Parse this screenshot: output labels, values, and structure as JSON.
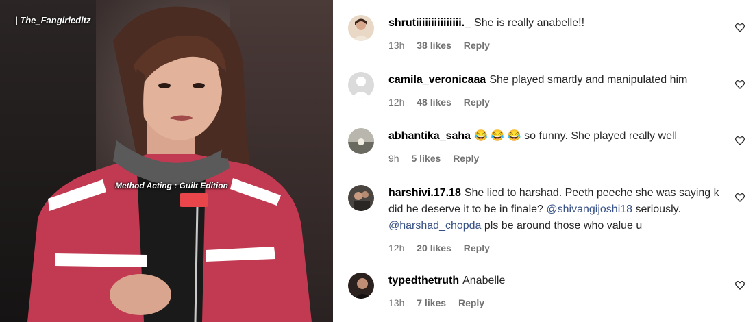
{
  "media": {
    "watermark": "| The_Fangirleditz",
    "caption": "Method Acting : Guilt Edition"
  },
  "icons": {
    "like": "heart-outline-icon",
    "avatar_default": "user-silhouette-icon"
  },
  "colors": {
    "mention": "#385185",
    "meta": "#737373"
  },
  "comments": [
    {
      "username": "shrutiiiiiiiiiiiiiii._",
      "text": "She is really anabelle!!",
      "time": "13h",
      "likes": "38 likes",
      "reply": "Reply"
    },
    {
      "username": "camila_veronicaaa",
      "text": "She played smartly and manipulated him",
      "time": "12h",
      "likes": "48 likes",
      "reply": "Reply"
    },
    {
      "username": "abhantika_saha",
      "emoji": "😂 😂 😂",
      "text": "so funny. She played really well",
      "time": "9h",
      "likes": "5 likes",
      "reply": "Reply"
    },
    {
      "username": "harshivi.17.18",
      "text_a": "She lied to harshad. Peeth peeche she was saying k did he deserve it to be in finale?",
      "mention_a": "@shivangijoshi18",
      "text_b": "seriously.",
      "mention_b": "@harshad_chopda",
      "text_c": "pls be around those who value u",
      "time": "12h",
      "likes": "20 likes",
      "reply": "Reply"
    },
    {
      "username": "typedthetruth",
      "text": "Anabelle",
      "time": "13h",
      "likes": "7 likes",
      "reply": "Reply"
    }
  ]
}
